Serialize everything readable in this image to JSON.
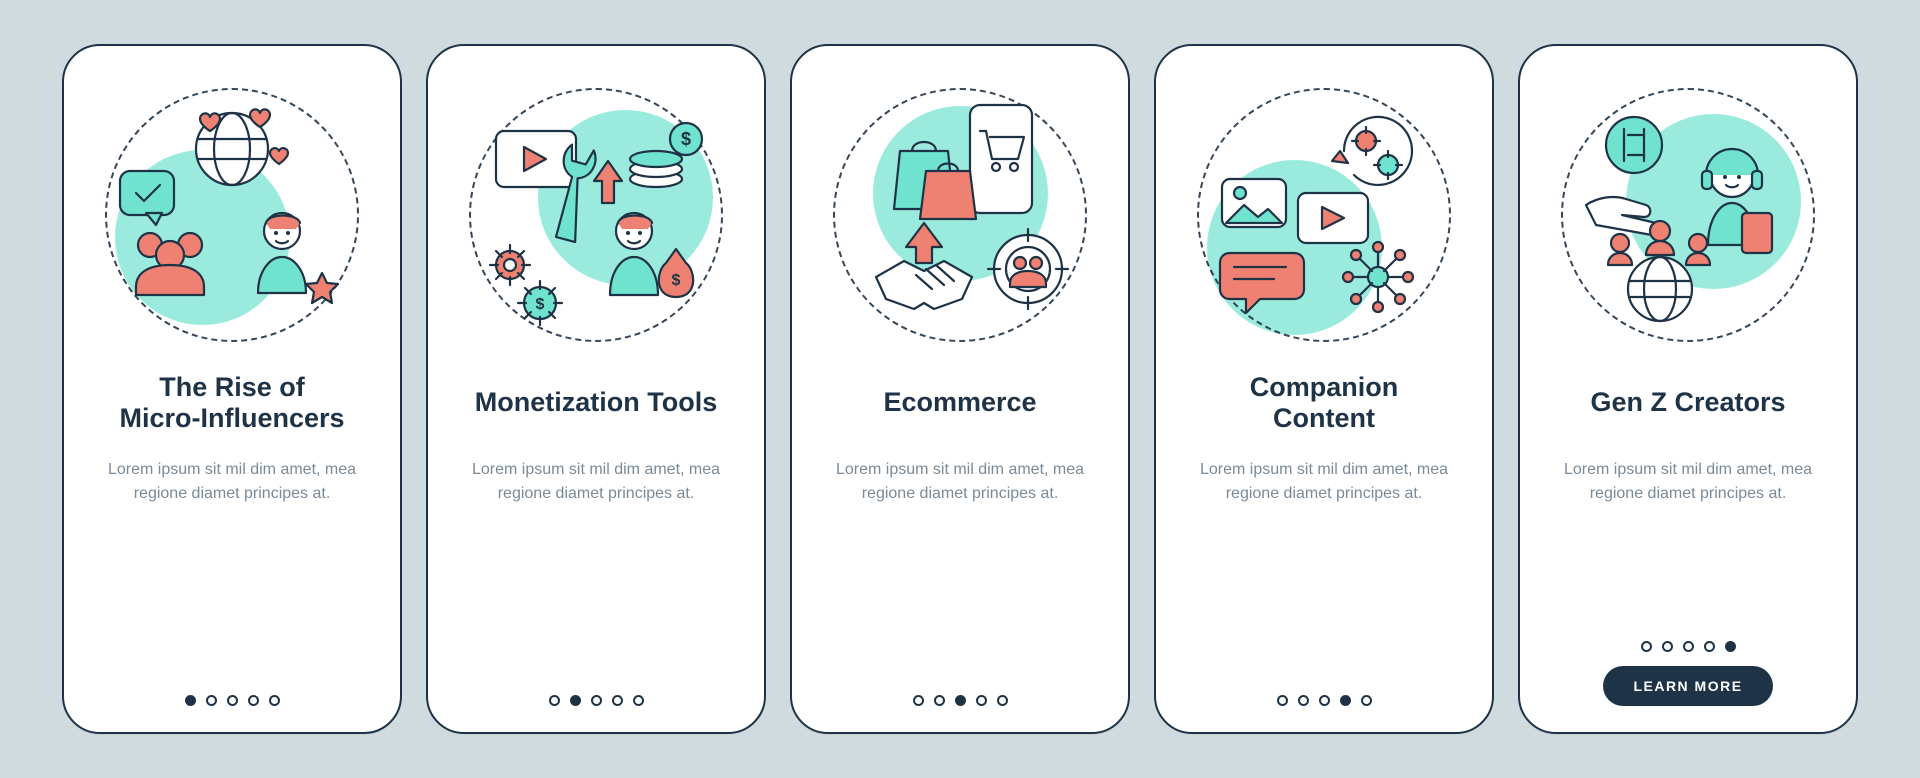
{
  "colors": {
    "background": "#cfdbde",
    "card": "#ffffff",
    "stroke": "#1f3347",
    "teal": "#6fe3ce",
    "coral": "#ef8172",
    "button": "#1f3347"
  },
  "lorem": "Lorem ipsum sit mil dim amet, mea regione diamet principes at.",
  "learn_more_label": "LEARN MORE",
  "slides": [
    {
      "id": "micro-influencers",
      "title": "The Rise of\nMicro-Influencers",
      "icon": "micro-influencers-icon",
      "active_index": 0,
      "has_button": false
    },
    {
      "id": "monetization-tools",
      "title": "Monetization Tools",
      "icon": "monetization-tools-icon",
      "active_index": 1,
      "has_button": false
    },
    {
      "id": "ecommerce",
      "title": "Ecommerce",
      "icon": "ecommerce-icon",
      "active_index": 2,
      "has_button": false
    },
    {
      "id": "companion-content",
      "title": "Companion\nContent",
      "icon": "companion-content-icon",
      "active_index": 3,
      "has_button": false
    },
    {
      "id": "gen-z-creators",
      "title": "Gen Z Creators",
      "icon": "gen-z-creators-icon",
      "active_index": 4,
      "has_button": true
    }
  ],
  "total_dots": 5
}
